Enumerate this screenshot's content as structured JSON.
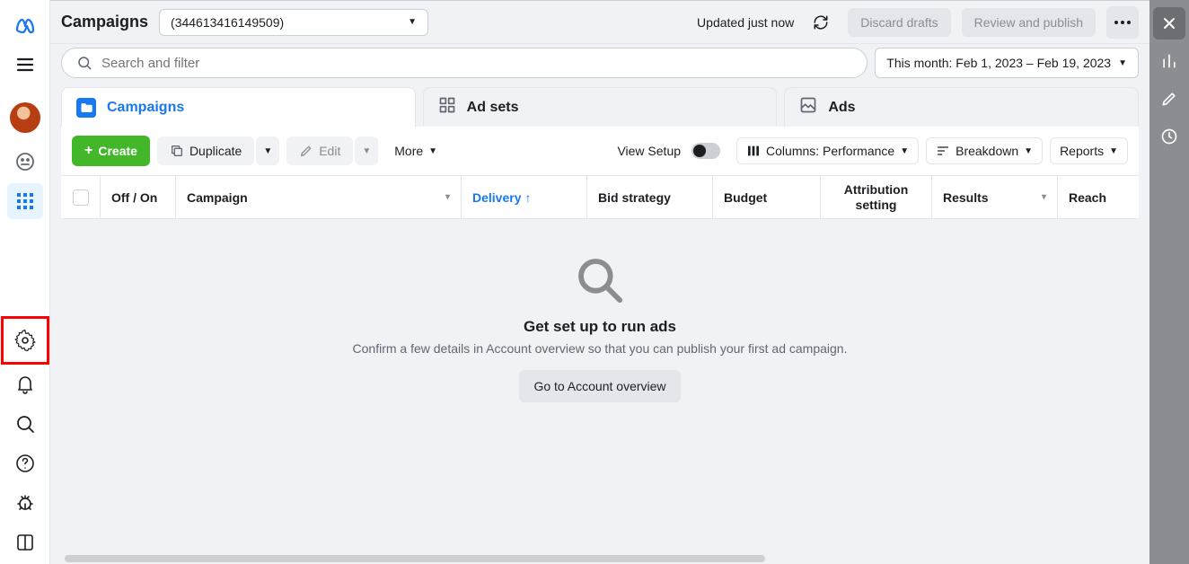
{
  "header": {
    "title": "Campaigns",
    "account_id": "(344613416149509)",
    "updated": "Updated just now",
    "discard": "Discard drafts",
    "review": "Review and publish"
  },
  "search": {
    "placeholder": "Search and filter",
    "date_range": "This month: Feb 1, 2023 – Feb 19, 2023"
  },
  "tabs": {
    "campaigns": "Campaigns",
    "adsets": "Ad sets",
    "ads": "Ads"
  },
  "toolbar": {
    "create": "Create",
    "duplicate": "Duplicate",
    "edit": "Edit",
    "more": "More",
    "view_setup": "View Setup",
    "columns": "Columns: Performance",
    "breakdown": "Breakdown",
    "reports": "Reports"
  },
  "columns": {
    "onoff": "Off / On",
    "campaign": "Campaign",
    "delivery": "Delivery",
    "bid": "Bid strategy",
    "budget": "Budget",
    "attribution": "Attribution setting",
    "results": "Results",
    "reach": "Reach"
  },
  "empty": {
    "title": "Get set up to run ads",
    "subtitle": "Confirm a few details in Account overview so that you can publish your first ad campaign.",
    "button": "Go to Account overview"
  }
}
